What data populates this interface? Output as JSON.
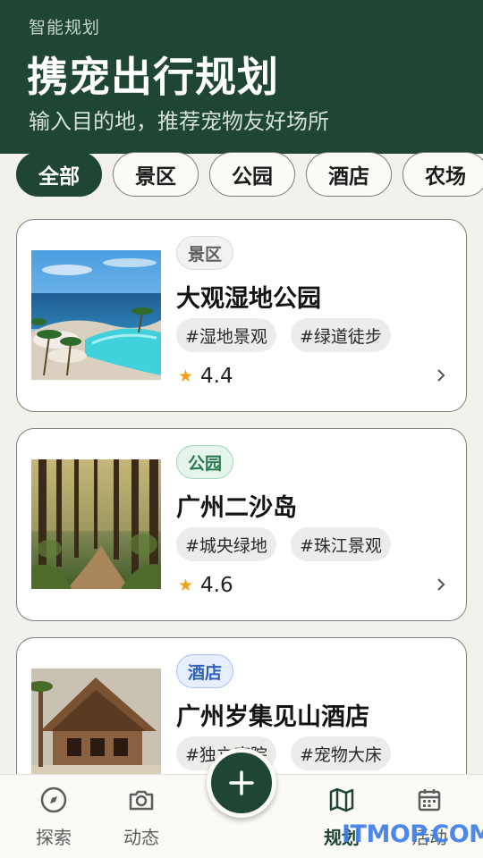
{
  "header": {
    "eyebrow": "智能规划",
    "title": "携宠出行规划",
    "subtitle": "输入目的地，推荐宠物友好场所"
  },
  "filters": [
    {
      "label": "全部",
      "active": true
    },
    {
      "label": "景区",
      "active": false
    },
    {
      "label": "公园",
      "active": false
    },
    {
      "label": "酒店",
      "active": false
    },
    {
      "label": "农场",
      "active": false
    }
  ],
  "places": [
    {
      "category": "景区",
      "name": "大观湿地公园",
      "tags": [
        "#湿地景观",
        "#绿道徒步"
      ],
      "rating": "4.4",
      "image": "resort-pool"
    },
    {
      "category": "公园",
      "name": "广州二沙岛",
      "tags": [
        "#城央绿地",
        "#珠江景观"
      ],
      "rating": "4.6",
      "image": "forest-path"
    },
    {
      "category": "酒店",
      "name": "广州岁集见山酒店",
      "tags": [
        "#独立庭院",
        "#宠物大床"
      ],
      "rating": "",
      "image": "wooden-lodge"
    }
  ],
  "icons": {
    "rating": "star-icon",
    "chevron": "chevron-right-icon",
    "fab": "plus-icon"
  },
  "nav": [
    {
      "label": "探索",
      "icon": "compass-icon",
      "active": false
    },
    {
      "label": "动态",
      "icon": "camera-icon",
      "active": false
    },
    {
      "label": "规划",
      "icon": "map-icon",
      "active": true
    },
    {
      "label": "活动",
      "icon": "calendar-icon",
      "active": false
    }
  ],
  "colors": {
    "brand": "#1e4632",
    "background": "#f3f1ec",
    "star": "#f0a020",
    "scenic_badge": "#606060",
    "park_badge": "#2b7a4d",
    "hotel_badge": "#2f5fbf"
  },
  "watermark": "ITMOP.COM"
}
